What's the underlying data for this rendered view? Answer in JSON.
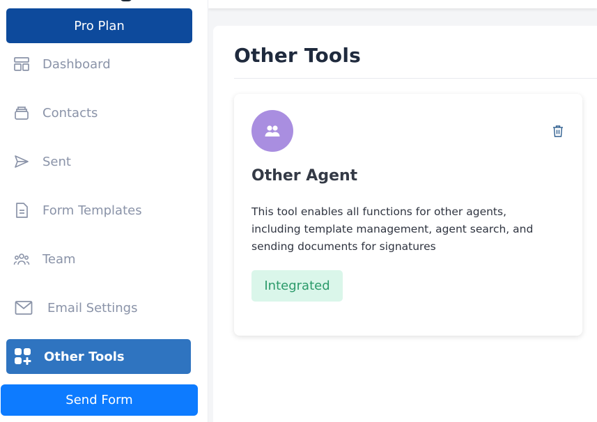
{
  "sidebar": {
    "plan_label": "Pro Plan",
    "items": [
      {
        "label": "Dashboard",
        "icon": "dashboard-icon"
      },
      {
        "label": "Contacts",
        "icon": "contacts-icon"
      },
      {
        "label": "Sent",
        "icon": "send-icon"
      },
      {
        "label": "Form Templates",
        "icon": "document-icon"
      },
      {
        "label": "Team",
        "icon": "team-icon"
      },
      {
        "label": "Email Settings",
        "icon": "mail-icon"
      },
      {
        "label": "Other Tools",
        "icon": "apps-add-icon",
        "active": true
      }
    ],
    "send_form_label": "Send Form"
  },
  "main": {
    "title": "Other Tools",
    "card": {
      "title": "Other Agent",
      "description": "This tool enables all functions for other agents, including template management, agent search, and sending documents for signatures",
      "status": "Integrated",
      "avatar_icon": "users-icon",
      "delete_icon": "trash-icon"
    }
  },
  "colors": {
    "plan_button": "#0d4a9c",
    "active_nav": "#2f74c0",
    "send_button": "#0d7bff",
    "avatar": "#a98ee0",
    "badge_bg": "#daf6ea",
    "badge_text": "#2b9a6a",
    "nav_text": "#8a93a8"
  }
}
